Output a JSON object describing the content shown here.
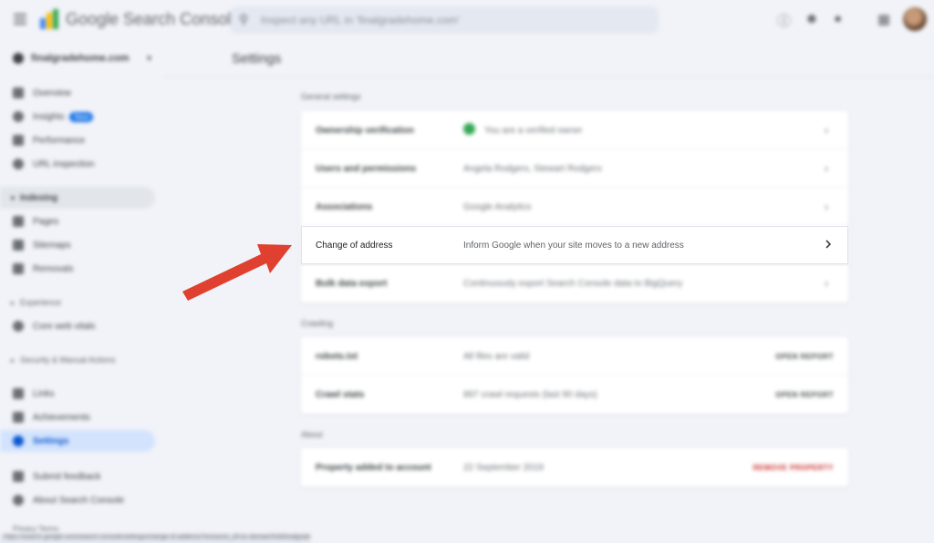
{
  "app": {
    "product_name": "Google Search Console",
    "search_placeholder": "Inspect any URL in ‘finalgradehome.com’",
    "property": "finalgradehome.com"
  },
  "sidebar": {
    "items": [
      {
        "label": "Overview",
        "icon": "home-icon"
      },
      {
        "label": "Insights",
        "icon": "insights-icon",
        "badge": "New"
      },
      {
        "label": "Performance",
        "icon": "trend-icon"
      },
      {
        "label": "URL inspection",
        "icon": "search-icon"
      }
    ],
    "indexing": {
      "label": "Indexing",
      "items": [
        {
          "label": "Pages",
          "icon": "pages-icon"
        },
        {
          "label": "Sitemaps",
          "icon": "sitemap-icon"
        },
        {
          "label": "Removals",
          "icon": "removals-icon"
        }
      ]
    },
    "experience": {
      "label": "Experience",
      "items": [
        {
          "label": "Core web vitals",
          "icon": "speed-icon"
        }
      ]
    },
    "security": {
      "label": "Security & Manual Actions"
    },
    "extra": [
      {
        "label": "Links",
        "icon": "links-icon"
      },
      {
        "label": "Achievements",
        "icon": "trophy-icon"
      },
      {
        "label": "Settings",
        "icon": "gear-icon"
      },
      {
        "label": "Submit feedback",
        "icon": "feedback-icon"
      },
      {
        "label": "About Search Console",
        "icon": "info-icon"
      }
    ],
    "footer": "Privacy   Terms"
  },
  "main": {
    "title": "Settings",
    "general": {
      "heading": "General settings",
      "rows": [
        {
          "label": "Ownership verification",
          "value": "You are a verified owner"
        },
        {
          "label": "Users and permissions",
          "value": "Angela Rodgers, Stewart Rodgers"
        },
        {
          "label": "Associations",
          "value": "Google Analytics"
        }
      ],
      "highlight": {
        "label": "Change of address",
        "value": "Inform Google when your site moves to a new address"
      },
      "after": [
        {
          "label": "Bulk data export",
          "value": "Continuously export Search Console data to BigQuery"
        }
      ]
    },
    "crawling": {
      "heading": "Crawling",
      "rows": [
        {
          "label": "robots.txt",
          "value": "All files are valid",
          "action": "OPEN REPORT"
        },
        {
          "label": "Crawl stats",
          "value": "897 crawl requests (last 90 days)",
          "action": "OPEN REPORT"
        }
      ]
    },
    "about": {
      "heading": "About",
      "rows": [
        {
          "label": "Property added to account",
          "value": "22 September 2019",
          "action": "REMOVE PROPERTY"
        }
      ]
    }
  },
  "status_url": "https://search.google.com/search-console/settings/change-of-address?resource_id=sc-domain%3Afinalgradehome.com",
  "colors": {
    "arrow": "#e0402f",
    "highlight_border": "#e0e3e8",
    "accent": "#1a73e8"
  }
}
